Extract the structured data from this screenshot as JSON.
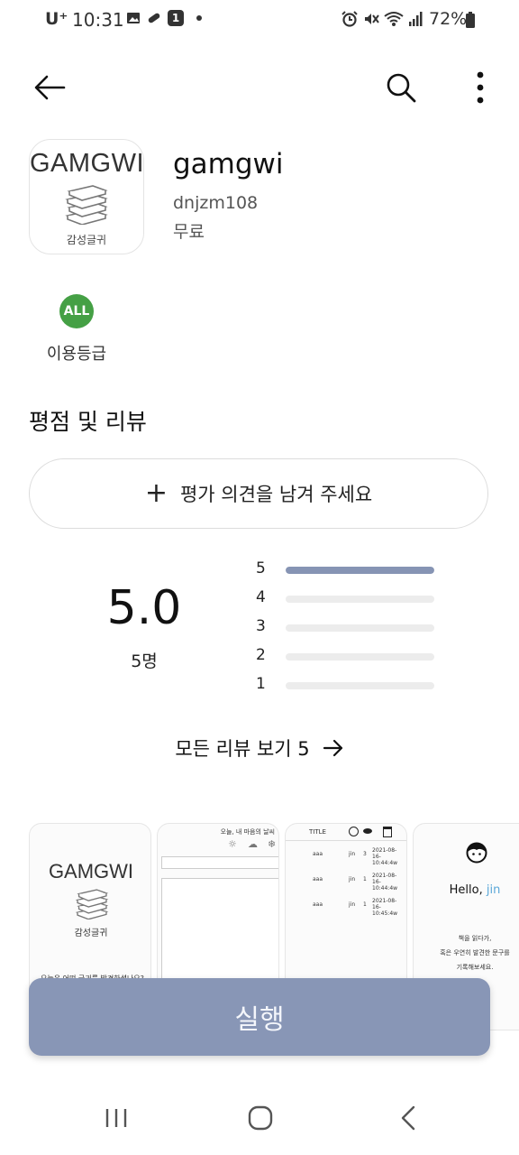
{
  "status_bar": {
    "carrier": "U⁺",
    "time": "10:31",
    "notification_badge": "1",
    "battery": "72%"
  },
  "app": {
    "name": "gamgwi",
    "developer": "dnjzm108",
    "price": "무료",
    "icon_title": "GAMGWI",
    "icon_subtitle": "감성글귀"
  },
  "age_rating": {
    "badge": "ALL",
    "label": "이용등급"
  },
  "reviews": {
    "section_title": "평점 및 리뷰",
    "write_button": "평가 의견을 남겨 주세요",
    "score": "5.0",
    "count": "5명",
    "distribution": [
      {
        "star": "5",
        "fraction": 1.0
      },
      {
        "star": "4",
        "fraction": 0.0
      },
      {
        "star": "3",
        "fraction": 0.0
      },
      {
        "star": "2",
        "fraction": 0.0
      },
      {
        "star": "1",
        "fraction": 0.0
      }
    ],
    "all_reviews_label": "모든 리뷰 보기 5"
  },
  "screenshots": {
    "shot1": {
      "title": "GAMGWI",
      "subtitle": "감성글귀",
      "bottom": "오늘은 어떤 글귀를 발견하셨나요?"
    },
    "shot2": {
      "header": "오늘, 내 마음의 날씨"
    },
    "shot3": {
      "header": "TITLE",
      "rows": [
        {
          "title": "aaa",
          "user": "jin",
          "count": "3",
          "date": "2021-08-16- 10:44:4w"
        },
        {
          "title": "aaa",
          "user": "jin",
          "count": "1",
          "date": "2021-08-16- 10:44:4w"
        },
        {
          "title": "aaa",
          "user": "jin",
          "count": "1",
          "date": "2021-08-16- 10:45:4w"
        }
      ]
    },
    "shot4": {
      "hello": "Hello,",
      "name": "jin",
      "line1": "책을 읽다가,",
      "line2": "혹은 우연히 발견한 문구를",
      "line3": "기록해보세요."
    }
  },
  "run_button": "실행",
  "colors": {
    "accent": "#8896b6",
    "bar_fill": "#8694b4",
    "age_badge": "#45a045"
  }
}
